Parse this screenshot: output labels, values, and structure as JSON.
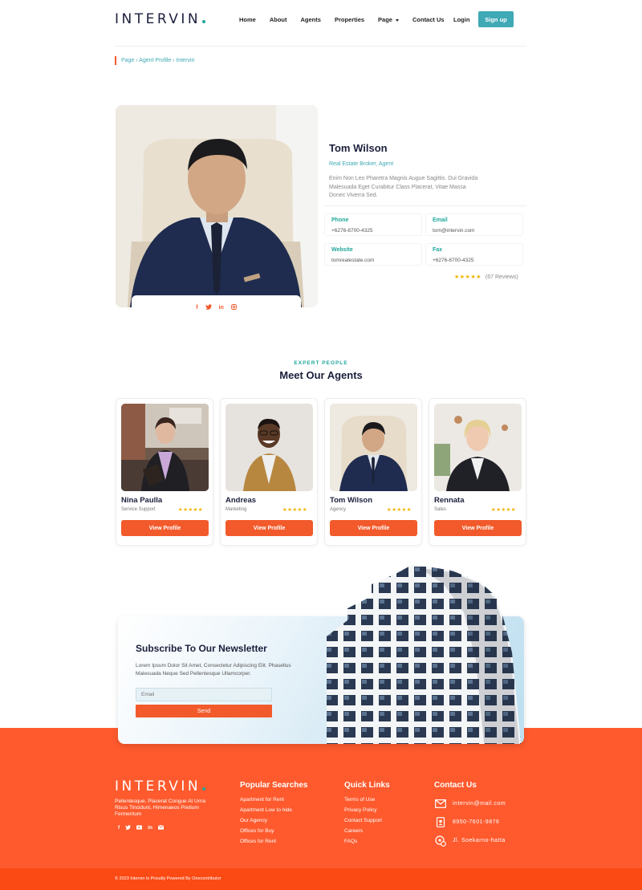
{
  "brand": {
    "name": "INTERVIN",
    "accent": "#1fa79a",
    "orange": "#f25a2b",
    "teal_button": "#3fa9b5"
  },
  "nav": {
    "items": [
      "Home",
      "About",
      "Agents",
      "Properties",
      "Page",
      "Contact Us"
    ],
    "login": "Login",
    "signup": "Sign up"
  },
  "breadcrumb": "Page › Agent Profile › Intervin",
  "profile": {
    "name": "Tom Wilson",
    "role": "Real Estate Broker, Agent",
    "description": "Enim Non Leo Pharetra Magnis Augue Sagittis. Dui Gravida Malesuada Eget Curabitur Class Placerat, Vitae Massa Donec Viverra Sed.",
    "phone_label": "Phone",
    "phone": "+6276-8700-4325",
    "email_label": "Email",
    "email": "tom@intervin.com",
    "website_label": "Website",
    "website": "tomrealestate.com",
    "fax_label": "Fax",
    "fax": "+6276-8700-4325",
    "rating_stars": "★★★★★",
    "reviews": "(67 Reviews)",
    "social": [
      "f",
      "t",
      "in",
      "ig"
    ]
  },
  "agents_section": {
    "eyebrow": "EXPERT PEOPLE",
    "title": "Meet Our Agents",
    "button_label": "View Profile",
    "stars": "★★★★★",
    "agents": [
      {
        "name": "Nina Paulla",
        "role": "Service Support"
      },
      {
        "name": "Andreas",
        "role": "Marketing"
      },
      {
        "name": "Tom Wilson",
        "role": "Agency"
      },
      {
        "name": "Rennata",
        "role": "Sales"
      }
    ]
  },
  "newsletter": {
    "title": "Subscribe To Our Newsletter",
    "description": "Lorem Ipsum Dolor Sit Amet, Consectetur Adipiscing Elit. Phasellus Malesuada Neque Sed Pellentesque Ullamcorper.",
    "placeholder": "Email",
    "button": "Send"
  },
  "footer": {
    "logo": "INTERVIN",
    "about": "Pellentesque, Placerat Congue At Urna Risus Tincidunt, Himenaeos Pretium Fermentum",
    "social": [
      "f",
      "t",
      "yt",
      "in",
      "mail"
    ],
    "popular": {
      "title": "Popular Searches",
      "items": [
        "Apartment for Rent",
        "Apartment Low to hide",
        "Our Agency",
        "Offices for Buy",
        "Offices for Rent"
      ]
    },
    "quick": {
      "title": "Quick Links",
      "items": [
        "Terms of Use",
        "Privacy Policy",
        "Contact Support",
        "Careers",
        "FAQs"
      ]
    },
    "contact": {
      "title": "Contact Us",
      "email": "intervin@mail.com",
      "phone": "8950-7601-9876",
      "address": "Jl. Soekarno-hatta"
    },
    "copyright": "© 2023 Intervin Is Proudly Powered By Onecontributor"
  }
}
